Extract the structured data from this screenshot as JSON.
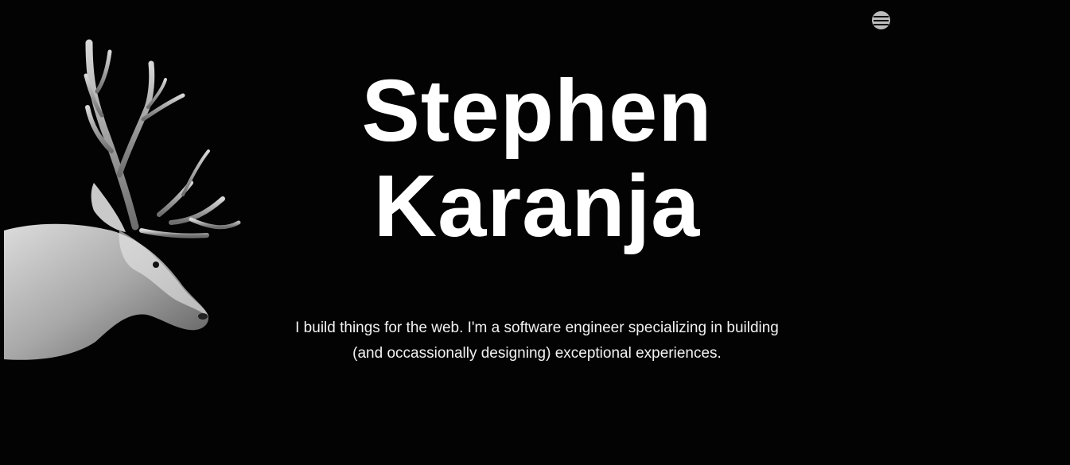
{
  "header": {
    "menu_icon": "hamburger-menu-icon"
  },
  "hero": {
    "image_icon": "deer-illustration",
    "name_line1": "Stephen",
    "name_line2": "Karanja",
    "tagline_line1": "I build things for the web. I'm a software engineer specializing in building",
    "tagline_line2": "(and occassionally designing) exceptional experiences."
  },
  "colors": {
    "background": "#030303",
    "text": "#ffffff",
    "menu_button": "#bdbdbd"
  }
}
